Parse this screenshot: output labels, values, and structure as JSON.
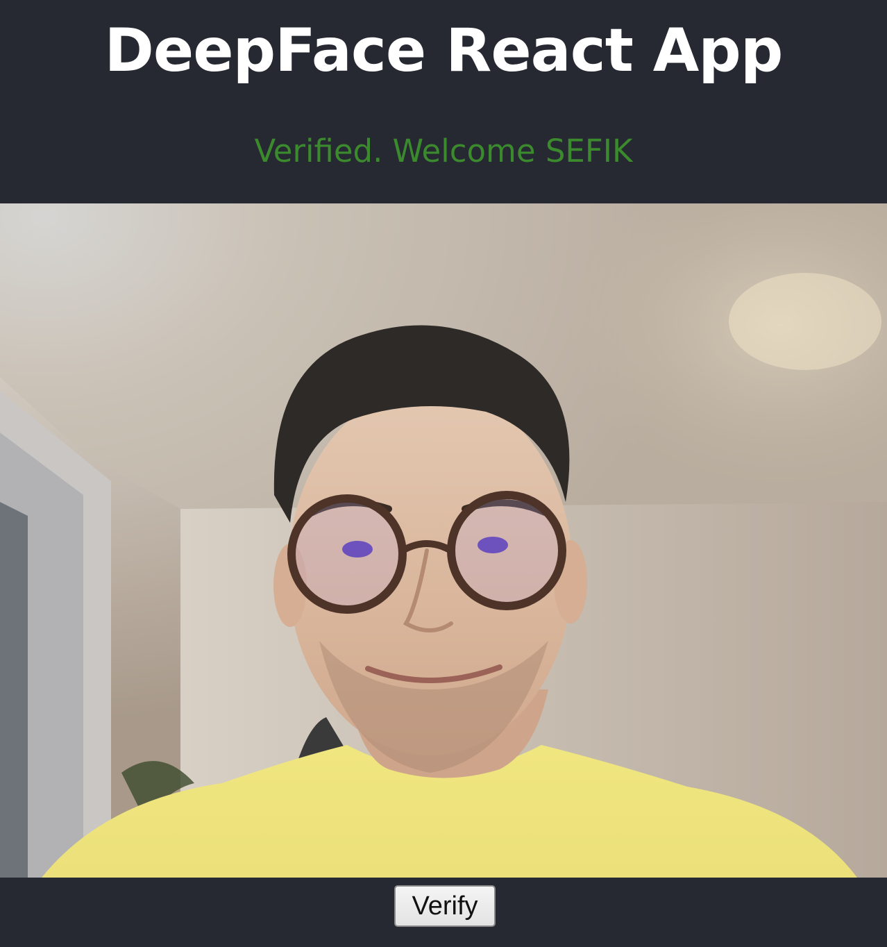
{
  "app": {
    "title": "DeepFace React App",
    "status_message": "Verified. Welcome SEFIK",
    "verify_label": "Verify",
    "colors": {
      "background": "#262931",
      "title": "#ffffff",
      "status_success": "#3c8a2e"
    }
  },
  "webcam": {
    "content": "webcam-frame"
  }
}
